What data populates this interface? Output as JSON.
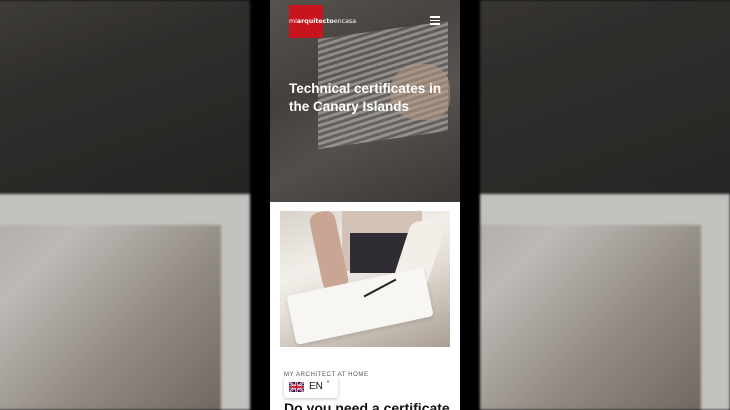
{
  "header": {
    "logo_light_1": "mi",
    "logo_bold": "arquitecto",
    "logo_light_2": "encasa",
    "menu_icon": "hamburger-menu-icon"
  },
  "hero": {
    "title": "Technical certificates in the Canary Islands"
  },
  "card": {
    "eyebrow": "MY ARCHITECT AT HOME",
    "title": "Do you need a certificate"
  },
  "language_switcher": {
    "flag_icon": "uk-flag-icon",
    "label": "EN",
    "chevron": "˄"
  },
  "colors": {
    "brand_red": "#c8141e",
    "hero_overlay": "#282624",
    "page_background": "#000000"
  }
}
